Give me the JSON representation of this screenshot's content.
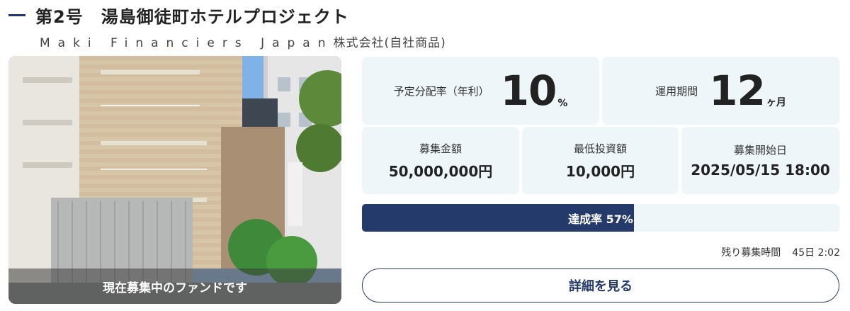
{
  "header": {
    "title": "第2号　湯島御徒町ホテルプロジェクト",
    "company_latin": "Maki Financiers Japan",
    "company_suffix": "株式会社(自社商品)"
  },
  "photo": {
    "caption": "現在募集中のファンドです"
  },
  "stats": {
    "yield_label": "予定分配率（年利）",
    "yield_value": "10",
    "yield_unit": "%",
    "term_label": "運用期間",
    "term_value": "12",
    "term_unit": "ヶ月",
    "amount_label": "募集金額",
    "amount_value": "50,000,000円",
    "min_label": "最低投資額",
    "min_value": "10,000円",
    "start_label": "募集開始日",
    "start_value": "2025/05/15 18:00"
  },
  "progress": {
    "label": "達成率 57%",
    "fraction": 0.57
  },
  "remaining": {
    "label": "残り募集時間",
    "value": "45日 2:02"
  },
  "actions": {
    "detail_label": "詳細を見る"
  },
  "colors": {
    "accent": "#233a6a",
    "card_bg": "#eef6fa"
  }
}
